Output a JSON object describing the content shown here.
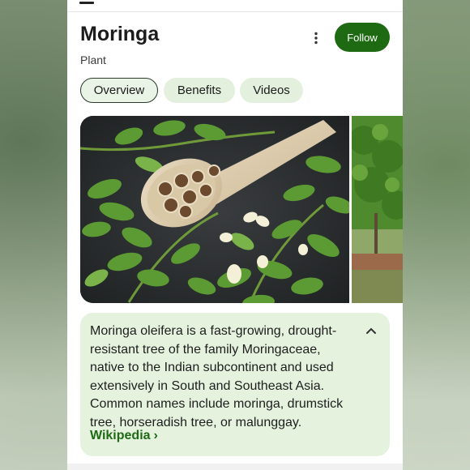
{
  "entity": {
    "title": "Moringa",
    "subtitle": "Plant",
    "follow_label": "Follow",
    "more_icon": "more-vert-icon"
  },
  "tabs": [
    {
      "label": "Overview",
      "active": true
    },
    {
      "label": "Benefits",
      "active": false
    },
    {
      "label": "Videos",
      "active": false
    }
  ],
  "images": [
    {
      "description_icon": "moringa-seeds-spoon-image"
    },
    {
      "description_icon": "moringa-tree-image"
    }
  ],
  "description": {
    "text": "Moringa oleifera is a fast-growing, drought-resistant tree of the family Moringaceae, native to the Indian subcontinent and used extensively in South and Southeast Asia. Common names include moringa, drumstick tree, horseradish tree, or malunggay.",
    "source_label": "Wikipedia",
    "source_chevron": "›"
  },
  "colors": {
    "accent_green": "#1e6a12",
    "chip_bg": "#e2f0dd",
    "desc_bg": "#e4f2de",
    "link_green": "#1f6a14"
  }
}
